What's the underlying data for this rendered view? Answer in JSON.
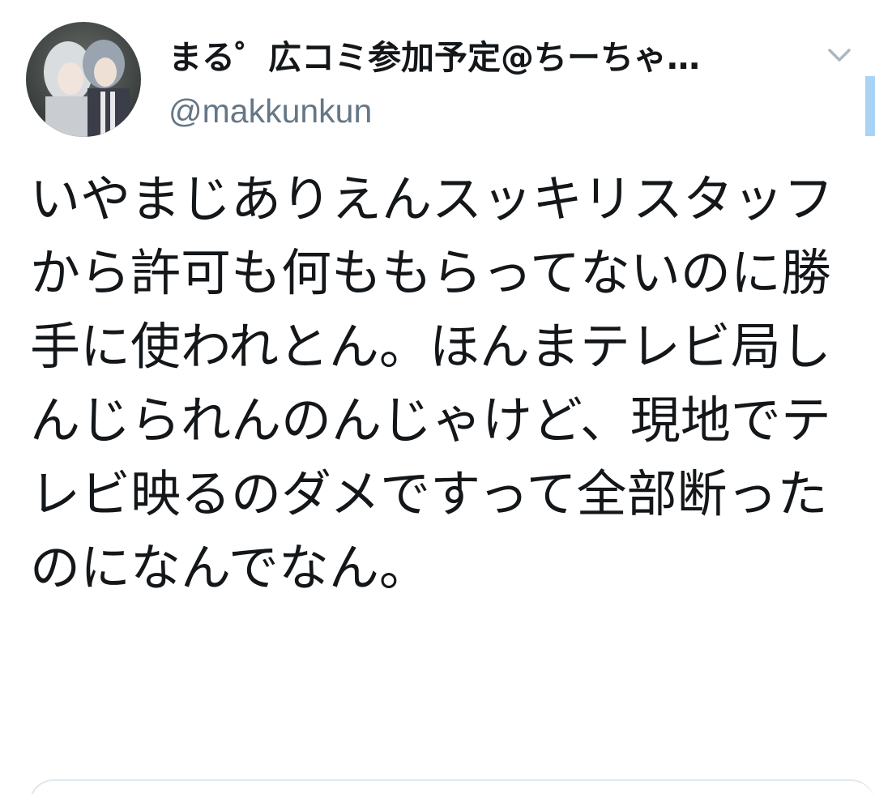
{
  "tweet": {
    "display_name": "まる゜広コミ参加予定@ちーちゃ…",
    "handle": "@makkunkun",
    "text": "いやまじありえんスッキリスタッフから許可も何ももらってないのに勝手に使われとん。ほんまテレビ局しんじられんのんじゃけど、現地でテレビ映るのダメですって全部断ったのになんでなん。"
  },
  "icons": {
    "avatar": "profile-photo",
    "caret": "chevron-down-icon"
  },
  "colors": {
    "text_primary": "#14171a",
    "text_secondary": "#657786",
    "caret": "#aab8c2",
    "scroll_indicator": "#a9d3f5",
    "border": "#e1e8ed"
  }
}
